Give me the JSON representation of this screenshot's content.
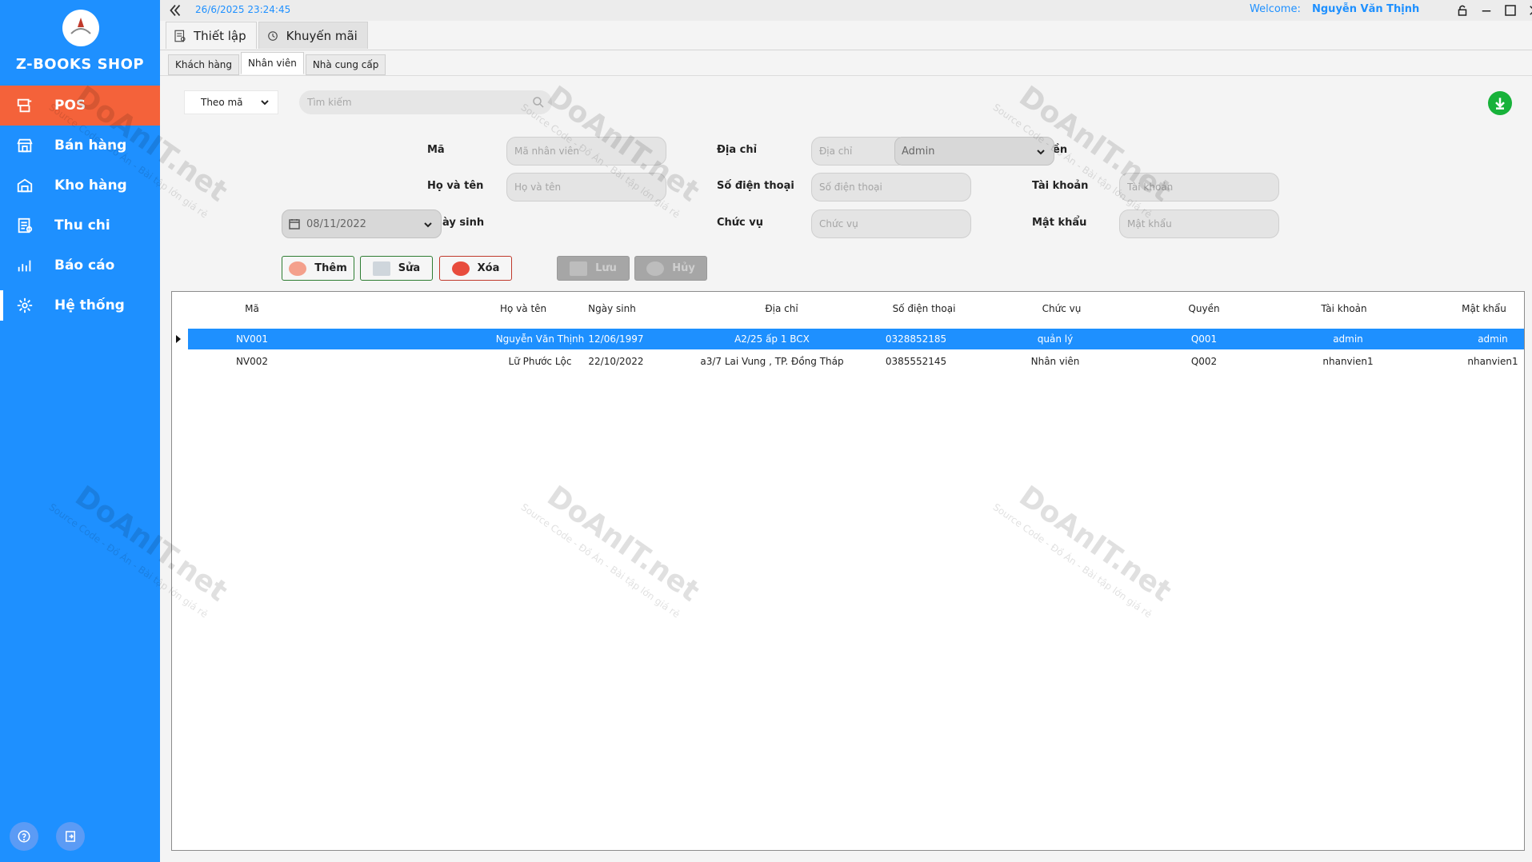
{
  "app": {
    "shop_name": "Z-BOOKS SHOP",
    "datetime": "26/6/2025 23:24:45",
    "welcome_label": "Welcome:",
    "user_name": "Nguyễn Văn Thịnh"
  },
  "sidebar": {
    "items": [
      {
        "label": "POS",
        "icon": "pos-icon"
      },
      {
        "label": "Bán hàng",
        "icon": "store-icon"
      },
      {
        "label": "Kho hàng",
        "icon": "warehouse-icon"
      },
      {
        "label": "Thu chi",
        "icon": "receipt-icon"
      },
      {
        "label": "Báo cáo",
        "icon": "chart-icon"
      },
      {
        "label": "Hệ thống",
        "icon": "gear-icon"
      }
    ]
  },
  "tabs": {
    "main": [
      {
        "label": "Thiết lập"
      },
      {
        "label": "Khuyến mãi"
      }
    ],
    "sub": [
      {
        "label": "Khách hàng"
      },
      {
        "label": "Nhân viên"
      },
      {
        "label": "Nhà cung cấp"
      }
    ]
  },
  "filter": {
    "mode": "Theo mã",
    "search_placeholder": "Tìm kiếm"
  },
  "form": {
    "labels": {
      "ma": "Mã",
      "ho_ten": "Họ và tên",
      "ngay_sinh": "ày sinh",
      "dia_chi": "Địa chỉ",
      "so_dien_thoai": "Số điện thoại",
      "chuc_vu": "Chức vụ",
      "quyen": "ền",
      "tai_khoan": "Tài khoản",
      "mat_khau": "Mật khẩu"
    },
    "placeholders": {
      "ma": "Mã nhân viên",
      "ho_ten": "Họ và tên",
      "dia_chi": "Địa chỉ",
      "so_dien_thoai": "Số điện thoại",
      "chuc_vu": "Chức vụ",
      "tai_khoan": "Tài khoản",
      "mat_khau": "Mật khẩu"
    },
    "date_value": "08/11/2022",
    "role_value": "Admin"
  },
  "buttons": {
    "add": "Thêm",
    "edit": "Sửa",
    "delete": "Xóa",
    "save": "Lưu",
    "cancel": "Hủy"
  },
  "table": {
    "columns": [
      "Mã",
      "Họ và tên",
      "Ngày sinh",
      "Địa chỉ",
      "Số điện thoại",
      "Chức vụ",
      "Quyền",
      "Tài khoản",
      "Mật khẩu"
    ],
    "rows": [
      [
        "NV001",
        "Nguyễn Văn Thịnh",
        "12/06/1997",
        "A2/25 ấp 1 BCX",
        "0328852185",
        "quản lý",
        "Q001",
        "admin",
        "admin"
      ],
      [
        "NV002",
        "Lữ Phước Lộc",
        "22/10/2022",
        "a3/7 Lai Vung , TP. Đồng Tháp",
        "0385552145",
        "Nhân viên",
        "Q002",
        "nhanvien1",
        "nhanvien1"
      ]
    ]
  },
  "watermark": {
    "brand": "DoAnIT.net",
    "tagline": "Source Code - Đồ Án - Bài tập lớn giá rẻ"
  },
  "colors": {
    "sidebar": "#1e90ff",
    "active_menu": "#f4623a",
    "selected_row": "#1e90ff",
    "download": "#18b23a"
  }
}
